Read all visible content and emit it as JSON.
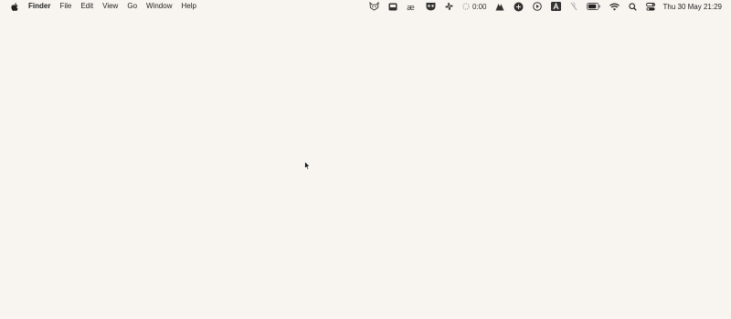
{
  "menubar": {
    "apple_icon": "apple-logo-icon",
    "app_name": "Finder",
    "menus": [
      "File",
      "Edit",
      "View",
      "Go",
      "Window",
      "Help"
    ],
    "status_icons": [
      "cat-head-icon",
      "inbox-tray-icon",
      "ae-ligature-icon",
      "shield-mask-icon",
      "slack-logo-icon",
      "timer-icon",
      "mountain-icon",
      "globe-badge-icon",
      "play-circle-icon",
      "a-square-icon",
      "mic-off-icon",
      "battery-icon",
      "wifi-icon",
      "spotlight-search-icon",
      "control-center-icon"
    ],
    "timer_text": "0:00",
    "clock": "Thu 30 May  21:29"
  },
  "colors": {
    "desktop_background": "#f8f4ef",
    "menu_text": "#222222"
  }
}
